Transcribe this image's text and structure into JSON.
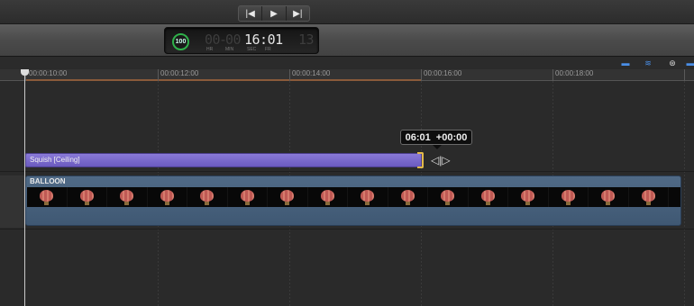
{
  "transport": {
    "prev_icon": "skip-back-icon",
    "prev_glyph": "|◀",
    "play_icon": "play-icon",
    "play_glyph": "▶",
    "next_icon": "skip-forward-icon",
    "next_glyph": "▶|"
  },
  "timecode": {
    "badge": "100",
    "hours": "00",
    "minutes": "00",
    "seconds_frames": "16:01",
    "tail": "13",
    "labels": {
      "hr": "HR",
      "min": "MIN",
      "sec": "SEC",
      "fr": "FR"
    }
  },
  "header_icons": [
    "clip-appearance-icon",
    "audio-waveform-icon",
    "snapping-icon",
    "zoom-icon"
  ],
  "ruler": {
    "ticks": [
      "00:00:10:00",
      "00:00:12:00",
      "00:00:14:00",
      "00:00:16:00",
      "00:00:18:00"
    ]
  },
  "tooltip": {
    "duration": "06:01",
    "delta": "+00:00"
  },
  "behavior": {
    "label": "Squish [Ceiling]"
  },
  "clip": {
    "label": "BALLOON"
  },
  "colors": {
    "behavior": "#7a6ad0",
    "clip": "#4a6480",
    "trim_handle": "#e2b94a",
    "accent_blue": "#4a8fe8",
    "badge_green": "#2fb14a"
  }
}
